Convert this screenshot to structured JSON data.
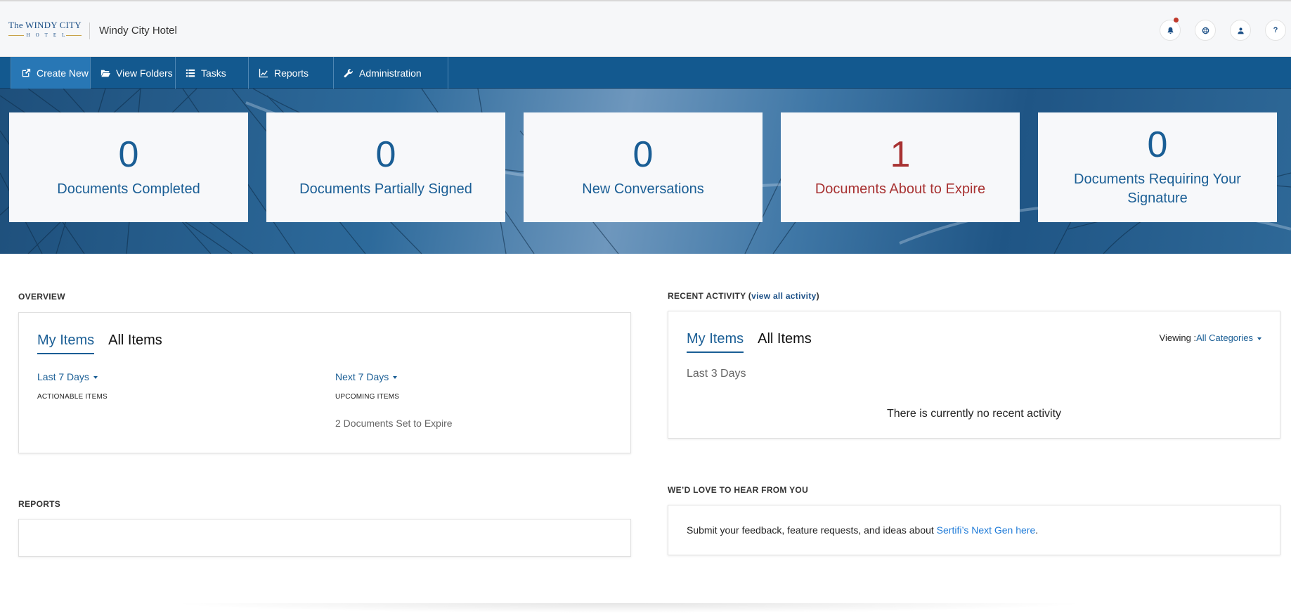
{
  "header": {
    "logo_line1": "The WINDY CITY",
    "logo_line2": "HOTEL",
    "company": "Windy City Hotel",
    "icons": [
      "bell-icon",
      "globe-icon",
      "user-icon",
      "help-icon"
    ],
    "help_glyph": "?"
  },
  "nav": [
    {
      "label": "Create New",
      "icon": "external-link-icon"
    },
    {
      "label": "View Folders",
      "icon": "folder-open-icon"
    },
    {
      "label": "Tasks",
      "icon": "list-icon"
    },
    {
      "label": "Reports",
      "icon": "line-chart-icon"
    },
    {
      "label": "Administration",
      "icon": "wrench-icon"
    }
  ],
  "stats": [
    {
      "value": "0",
      "label": "Documents Completed"
    },
    {
      "value": "0",
      "label": "Documents Partially Signed"
    },
    {
      "value": "0",
      "label": "New Conversations"
    },
    {
      "value": "1",
      "label": "Documents About to Expire"
    },
    {
      "value": "0",
      "label": "Documents Requiring Your Signature"
    }
  ],
  "colors": {
    "primary": "#13598f",
    "accent": "#1a5e95",
    "warning": "#a83232",
    "link": "#1f7bd8"
  },
  "overview": {
    "title": "OVERVIEW",
    "tabs": [
      "My Items",
      "All Items"
    ],
    "left_dropdown": "Last 7 Days",
    "left_caption": "ACTIONABLE ITEMS",
    "right_dropdown": "Next 7 Days",
    "right_caption": "UPCOMING ITEMS",
    "upcoming_text": "2 Documents Set to Expire"
  },
  "recent": {
    "title": "RECENT ACTIVITY (",
    "link": "view all activity",
    "title_end": ")",
    "tabs": [
      "My Items",
      "All Items"
    ],
    "viewing_label": "Viewing :",
    "viewing_value": "All Categories",
    "range": "Last 3 Days",
    "empty_message": "There is currently no recent activity"
  },
  "reports": {
    "title": "REPORTS"
  },
  "feedback": {
    "title": "WE’D LOVE TO HEAR FROM YOU",
    "text": "Submit your feedback, feature requests, and ideas about ",
    "link": "Sertifi’s Next Gen here",
    "end": "."
  }
}
